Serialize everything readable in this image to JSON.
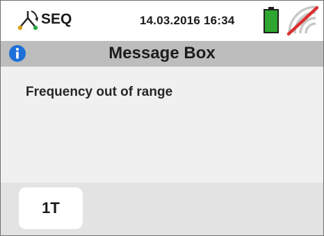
{
  "status_bar": {
    "mode_icon": "three-phase-sequence-icon",
    "mode_label": "SEQ",
    "date": "14.03.2016",
    "time": "16:34",
    "battery_icon": "battery-full-icon",
    "signal_icon": "wifi-off-icon"
  },
  "title_bar": {
    "icon": "info-icon",
    "title": "Message Box"
  },
  "message": {
    "text": "Frequency out of range"
  },
  "footer": {
    "key_label": "1T"
  },
  "colors": {
    "title_bar_bg": "#bdbdbd",
    "info_icon": "#1e6fd9",
    "battery_fill": "#2fa62f",
    "signal_strike": "#d93030",
    "signal_arcs": "#c8c8c8",
    "footer_bg": "#e3e3e3"
  }
}
